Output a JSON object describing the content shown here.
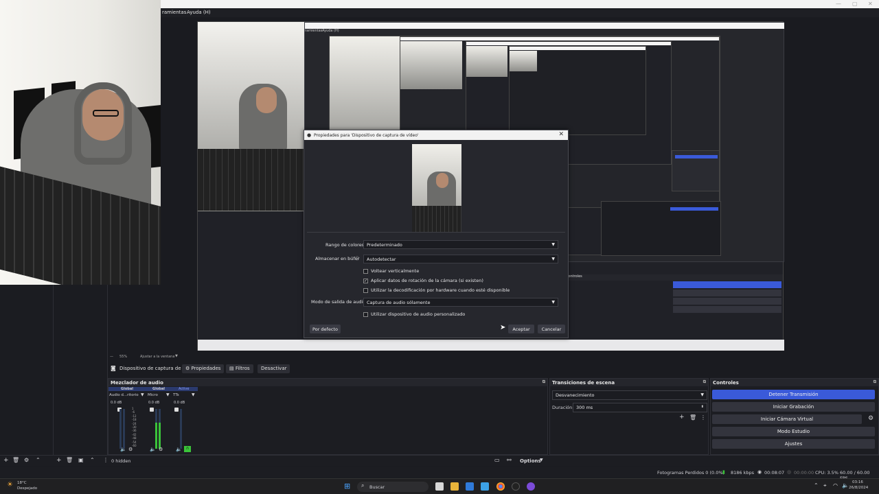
{
  "menubar": {
    "tools": "ramientas",
    "help": "Ayuda (H)"
  },
  "nested_menu": {
    "tools": "ramientas",
    "help": "Ayuda (H)"
  },
  "dialog": {
    "title": "Propiedades para 'Dispositivo de captura de vídeo'",
    "color_range_label": "Rango de colores",
    "color_range_value": "Predeterminado",
    "buffer_label": "Almacenar en búfer",
    "buffer_value": "Autodetectar",
    "flip_label": "Voltear verticalmente",
    "rotation_label": "Aplicar datos de rotación de la cámara (si existen)",
    "hwdecode_label": "Utilizar la decodificación por hardware cuando esté disponible",
    "audio_mode_label": "Modo de salida de audio",
    "audio_mode_value": "Captura de audio sólamente",
    "custom_audio_label": "Utilizar dispositivo de audio personalizado",
    "defaults_btn": "Por defecto",
    "ok_btn": "Aceptar",
    "cancel_btn": "Cancelar"
  },
  "zoom": {
    "value": "55%",
    "fit": "Ajustar a la ventana"
  },
  "toolbar": {
    "source": "Dispositivo de captura de v",
    "properties": "Propiedades",
    "filters": "Filtros",
    "deactivate": "Desactivar"
  },
  "mixer": {
    "title": "Mezclador de audio",
    "channels": [
      {
        "tag": "Global",
        "name": "Audio d...ritorio",
        "db": "0.0 dB"
      },
      {
        "tag": "Global",
        "name": "Micro",
        "db": "0.0 dB"
      },
      {
        "tag": "Active",
        "name": "TTs",
        "db": "0.0 dB"
      }
    ],
    "scale": [
      "1",
      "-6",
      "-12",
      "-18",
      "-24",
      "-30",
      "-36",
      "-42",
      "-48",
      "-54",
      "-60"
    ]
  },
  "transitions": {
    "title": "Transiciones de escena",
    "value": "Desvanecimiento",
    "duration_label": "Duración",
    "duration_value": "300 ms"
  },
  "controls": {
    "title": "Controles",
    "stop_stream": "Detener Transmisión",
    "start_rec": "Iniciar Grabación",
    "virtual_cam": "Iniciar Cámara Virtual",
    "studio": "Modo Estudio",
    "settings": "Ajustes"
  },
  "bottom": {
    "hidden": "0 hidden",
    "options": "Options"
  },
  "statusbar": {
    "dropped": "Fotogramas Perdidos 0 (0.0%)",
    "bitrate": "8186 kbps",
    "rec_time": "00:08:07",
    "stream_time": "00:00:00",
    "cpu": "CPU: 3.5%",
    "fps": "60.00 / 60.00 FPS"
  },
  "taskbar": {
    "temp": "18°C",
    "weather": "Despejado",
    "search": "Buscar",
    "time": "03:16",
    "date": "26/8/2024"
  },
  "colors": {
    "accent": "#3a5ad9",
    "meter": "#3ac43a",
    "bg": "#1c1d22"
  }
}
